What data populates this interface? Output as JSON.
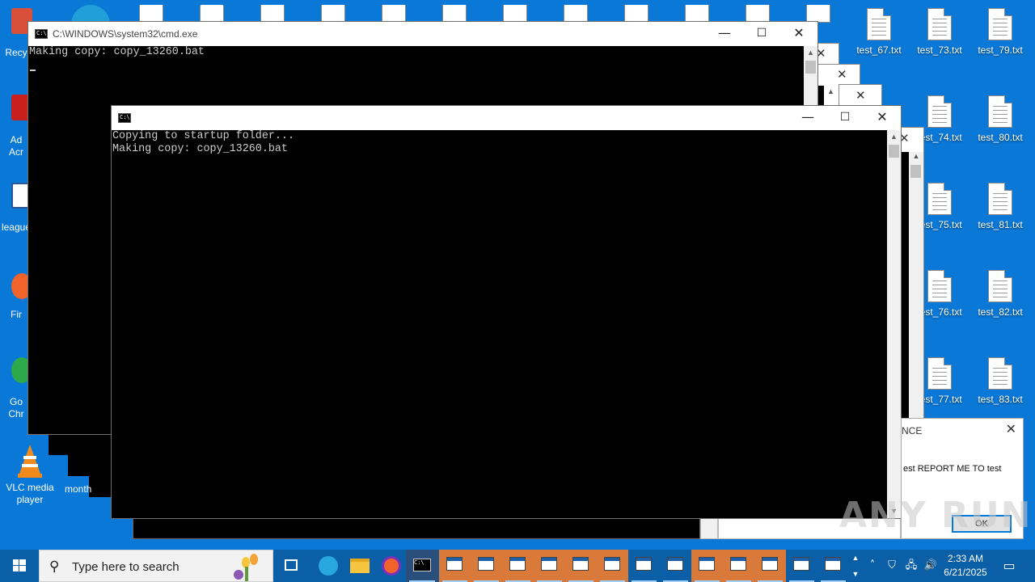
{
  "desktop": {
    "file_icons": [
      {
        "label": "test_67.txt"
      },
      {
        "label": "test_73.txt"
      },
      {
        "label": "test_79.txt"
      },
      {
        "label": "test_74.txt"
      },
      {
        "label": "test_80.txt"
      },
      {
        "label": "test_75.txt"
      },
      {
        "label": "test_81.txt"
      },
      {
        "label": "test_76.txt"
      },
      {
        "label": "test_82.txt"
      },
      {
        "label": "test_77.txt"
      },
      {
        "label": "test_83.txt"
      }
    ],
    "left_icons": [
      {
        "label": "Recy"
      },
      {
        "label": "Ad"
      },
      {
        "label": "Acr"
      },
      {
        "label": "league"
      },
      {
        "label": "Fir"
      },
      {
        "label": "Go"
      },
      {
        "label": "Chr"
      }
    ],
    "vlc_label_1": "VLC media",
    "vlc_label_2": "player",
    "month_label": "month"
  },
  "cmd_back": {
    "title": "C:\\WINDOWS\\system32\\cmd.exe",
    "output": "Making copy: copy_13260.bat"
  },
  "cmd_front": {
    "title": "",
    "output": "Copying to startup folder...\nMaking copy: copy_13260.bat"
  },
  "dialog": {
    "title": "NCE",
    "message": "est REPORT ME TO test",
    "ok_label": "OK"
  },
  "watermark": "ANY RUN",
  "taskbar": {
    "search_placeholder": "Type here to search",
    "time": "2:33 AM",
    "date": "6/21/2025"
  },
  "colors": {
    "desktop": "#0a78d7",
    "taskbar": "#0b5fa7",
    "taskbar_window_highlight": "#d97a3a"
  }
}
